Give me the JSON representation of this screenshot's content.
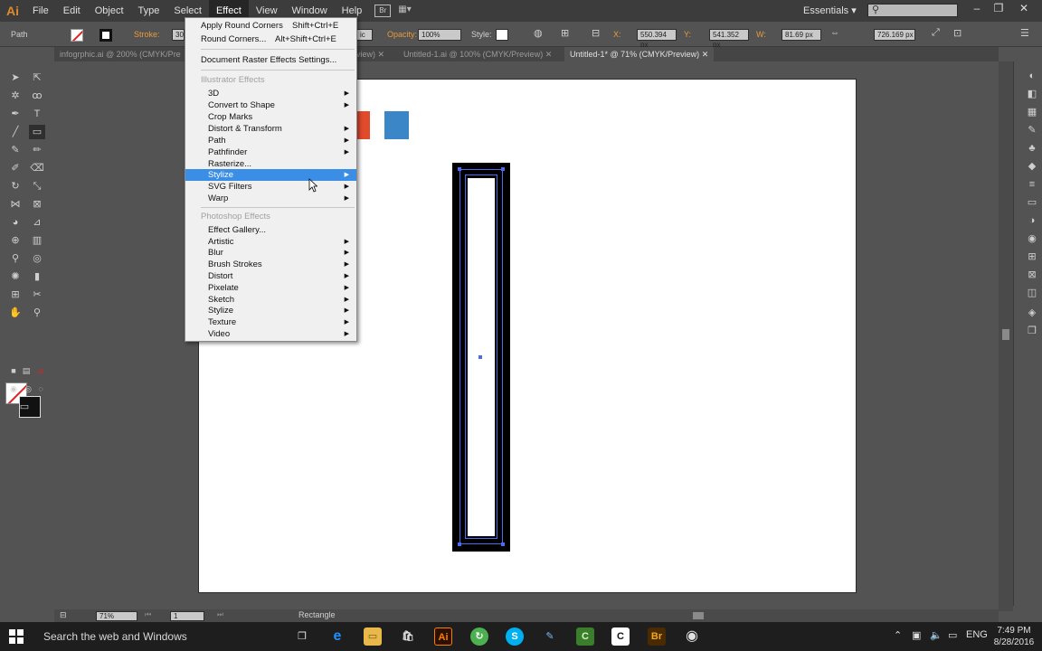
{
  "app": {
    "logo": "Ai"
  },
  "menubar": {
    "items": [
      "File",
      "Edit",
      "Object",
      "Type",
      "Select",
      "Effect",
      "View",
      "Window",
      "Help"
    ],
    "active": "Effect",
    "bridge_label": "Br",
    "workspace": "Essentials",
    "search_placeholder": ""
  },
  "controlbar": {
    "selection_label": "Path",
    "stroke_label": "Stroke:",
    "stroke_value": "30",
    "style_value": "ic",
    "opacity_label": "Opacity:",
    "opacity_value": "100%",
    "styles_label": "Style:",
    "x_label": "X:",
    "x_value": "550.394 px",
    "y_label": "Y:",
    "y_value": "541.352 px",
    "w_label": "W:",
    "w_value": "81.69 px",
    "h_value": "726.169 px"
  },
  "tabs": [
    {
      "label": "infogrphic.ai @ 200% (CMYK/Pre",
      "active": false
    },
    {
      "label": "view)",
      "active": false
    },
    {
      "label": "Untitled-1.ai @ 100% (CMYK/Preview)",
      "active": false
    },
    {
      "label": "Untitled-1* @ 71% (CMYK/Preview)",
      "active": true
    }
  ],
  "effect_menu": {
    "apply_round_corners": {
      "label": "Apply Round Corners",
      "shortcut": "Shift+Ctrl+E"
    },
    "round_corners": {
      "label": "Round Corners...",
      "shortcut": "Alt+Shift+Ctrl+E"
    },
    "document_raster": {
      "label": "Document Raster Effects Settings..."
    },
    "illustrator_header": "Illustrator Effects",
    "illustrator_items": [
      {
        "label": "3D",
        "submenu": true
      },
      {
        "label": "Convert to Shape",
        "submenu": true
      },
      {
        "label": "Crop Marks",
        "submenu": false
      },
      {
        "label": "Distort & Transform",
        "submenu": true
      },
      {
        "label": "Path",
        "submenu": true
      },
      {
        "label": "Pathfinder",
        "submenu": true
      },
      {
        "label": "Rasterize...",
        "submenu": false
      },
      {
        "label": "Stylize",
        "submenu": true,
        "highlighted": true
      },
      {
        "label": "SVG Filters",
        "submenu": true
      },
      {
        "label": "Warp",
        "submenu": true
      }
    ],
    "photoshop_header": "Photoshop Effects",
    "photoshop_items": [
      {
        "label": "Effect Gallery...",
        "submenu": false
      },
      {
        "label": "Artistic",
        "submenu": true
      },
      {
        "label": "Blur",
        "submenu": true
      },
      {
        "label": "Brush Strokes",
        "submenu": true
      },
      {
        "label": "Distort",
        "submenu": true
      },
      {
        "label": "Pixelate",
        "submenu": true
      },
      {
        "label": "Sketch",
        "submenu": true
      },
      {
        "label": "Stylize",
        "submenu": true
      },
      {
        "label": "Texture",
        "submenu": true
      },
      {
        "label": "Video",
        "submenu": true
      }
    ]
  },
  "statusbar": {
    "zoom": "71%",
    "page": "1",
    "current_tool": "Rectangle"
  },
  "canvas_colors": {
    "red_square": "#e24a2c",
    "blue_square": "#3b86c6",
    "selection": "#4a6cf0"
  },
  "taskbar": {
    "search_text": "Search the web and Windows",
    "tray_lang": "ENG",
    "time": "7:49 PM",
    "date": "8/28/2016",
    "apps": [
      "task-view",
      "edge",
      "file-explorer",
      "store",
      "illustrator",
      "app-green",
      "skype",
      "app-blue",
      "camtasia",
      "camtasia-recorder",
      "bridge",
      "chrome"
    ]
  }
}
